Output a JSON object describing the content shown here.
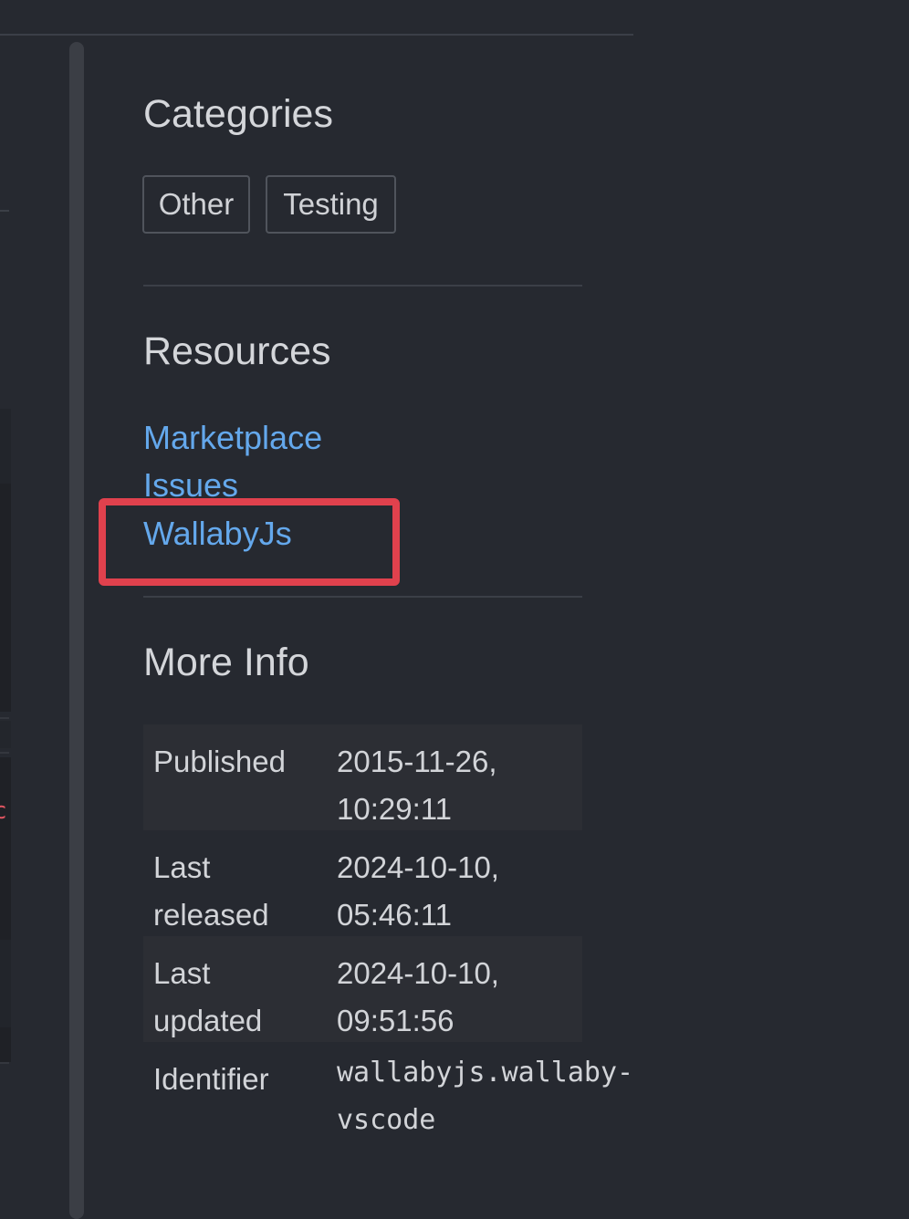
{
  "categories": {
    "heading": "Categories",
    "tags": [
      "Other",
      "Testing"
    ]
  },
  "resources": {
    "heading": "Resources",
    "links": [
      "Marketplace",
      "Issues",
      "WallabyJs"
    ]
  },
  "more_info": {
    "heading": "More Info",
    "rows": [
      {
        "label_line1": "Published",
        "label_line2": "",
        "value_line1": "2015-11-26,",
        "value_line2": "10:29:11"
      },
      {
        "label_line1": "Last",
        "label_line2": "released",
        "value_line1": "2024-10-10,",
        "value_line2": "05:46:11"
      },
      {
        "label_line1": "Last",
        "label_line2": "updated",
        "value_line1": "2024-10-10,",
        "value_line2": "09:51:56"
      },
      {
        "label_line1": "Identifier",
        "label_line2": "",
        "value_line1": "wallabyjs.wallaby-",
        "value_line2": "vscode"
      }
    ]
  },
  "annotation": {
    "highlight_color": "#e0414d",
    "highlighted_item": "WallabyJs"
  },
  "left_partial_glyph": "c",
  "colors": {
    "background": "#262930",
    "link": "#64a8ec",
    "text": "#d2d4d8"
  }
}
